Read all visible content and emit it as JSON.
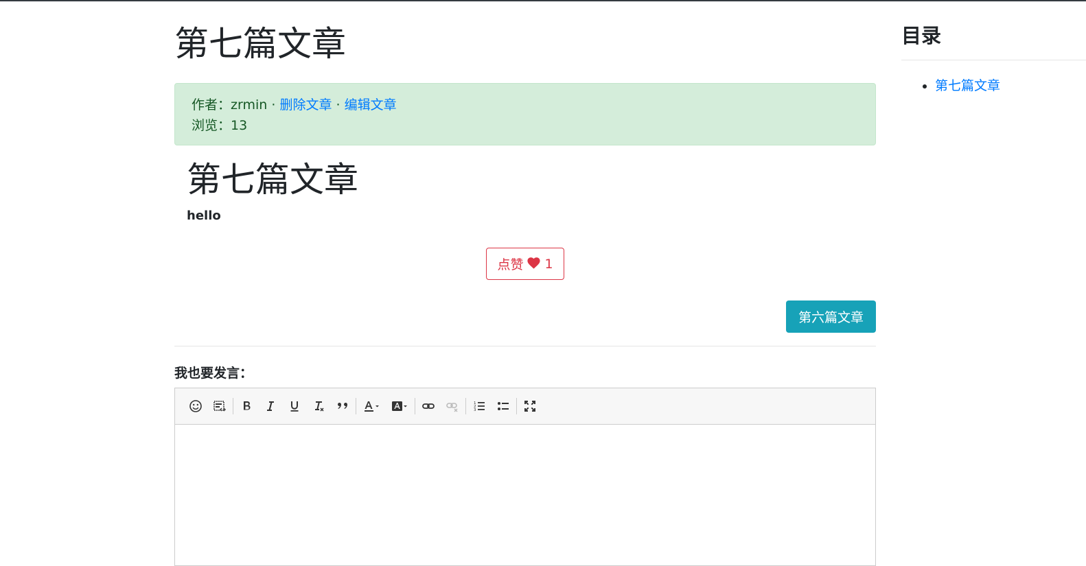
{
  "article": {
    "title": "第七篇文章",
    "author_label": "作者：",
    "author": "zrmin",
    "separator": "·",
    "delete_link": "删除文章",
    "edit_link": "编辑文章",
    "views_label": "浏览：",
    "views": "13",
    "body_heading": "第七篇文章",
    "body_text": "hello"
  },
  "like": {
    "label": "点赞",
    "count": "1",
    "icon": "heart-icon",
    "color": "#dc3545"
  },
  "next_article": {
    "label": "第六篇文章",
    "color": "#17a2b8"
  },
  "comment": {
    "label": "我也要发言：",
    "toolbar_icons": [
      "emoji-icon",
      "source-code-icon",
      "bold-icon",
      "italic-icon",
      "underline-icon",
      "clear-format-icon",
      "quote-icon",
      "text-color-icon",
      "background-color-icon",
      "link-icon",
      "unlink-icon",
      "ordered-list-icon",
      "unordered-list-icon",
      "fullscreen-icon"
    ]
  },
  "toc": {
    "title": "目录",
    "items": [
      {
        "label": "第七篇文章"
      }
    ]
  }
}
